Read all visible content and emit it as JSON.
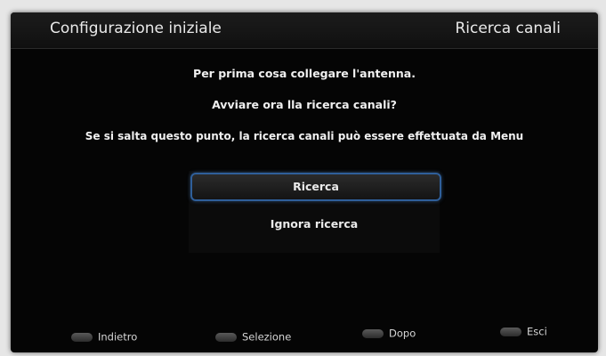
{
  "header": {
    "title": "Configurazione iniziale",
    "section": "Ricerca canali"
  },
  "messages": {
    "line1": "Per prima cosa collegare l'antenna.",
    "line2": "Avviare ora lla ricerca canali?",
    "line3": "Se si salta questo punto, la ricerca canali può essere effettuata da Menu"
  },
  "options": {
    "search": "Ricerca",
    "skip": "Ignora ricerca",
    "selected": "Ricerca"
  },
  "footer": {
    "back": "Indietro",
    "select": "Selezione",
    "next": "Dopo",
    "exit": "Esci"
  },
  "colors": {
    "accent": "#2f5f9a",
    "background": "#050505",
    "text": "#f0f0f0"
  }
}
